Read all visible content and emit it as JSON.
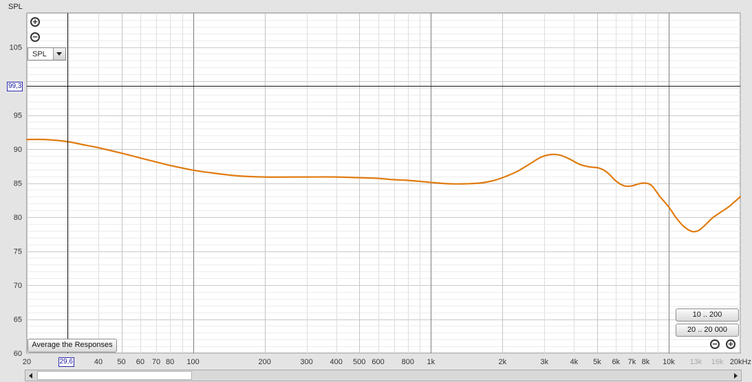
{
  "chart_data": {
    "type": "line",
    "ylabel": "SPL",
    "xunit": "Hz",
    "x_scale": "log",
    "xlim": [
      20,
      20000
    ],
    "ylim": [
      60,
      110
    ],
    "y_ticks": [
      60,
      65,
      70,
      75,
      80,
      85,
      90,
      95,
      105
    ],
    "x_ticks": [
      {
        "value": 20,
        "label": "20"
      },
      {
        "value": 40,
        "label": "40"
      },
      {
        "value": 50,
        "label": "50"
      },
      {
        "value": 60,
        "label": "60"
      },
      {
        "value": 70,
        "label": "70"
      },
      {
        "value": 80,
        "label": "80"
      },
      {
        "value": 100,
        "label": "100"
      },
      {
        "value": 200,
        "label": "200"
      },
      {
        "value": 300,
        "label": "300"
      },
      {
        "value": 400,
        "label": "400"
      },
      {
        "value": 500,
        "label": "500"
      },
      {
        "value": 600,
        "label": "600"
      },
      {
        "value": 800,
        "label": "800"
      },
      {
        "value": 1000,
        "label": "1k"
      },
      {
        "value": 2000,
        "label": "2k"
      },
      {
        "value": 3000,
        "label": "3k"
      },
      {
        "value": 4000,
        "label": "4k"
      },
      {
        "value": 5000,
        "label": "5k"
      },
      {
        "value": 6000,
        "label": "6k"
      },
      {
        "value": 7000,
        "label": "7k"
      },
      {
        "value": 8000,
        "label": "8k"
      },
      {
        "value": 10000,
        "label": "10k"
      },
      {
        "value": 13000,
        "label": "13k",
        "dim": true
      },
      {
        "value": 16000,
        "label": "16k",
        "dim": true
      },
      {
        "value": 20000,
        "label": "20kHz"
      }
    ],
    "cursor": {
      "x": 29.6,
      "y": 99.3,
      "x_label": "29,6",
      "y_label": "99,3"
    },
    "grid": true,
    "series": [
      {
        "color": "#e07b10",
        "points": [
          [
            20,
            91.4
          ],
          [
            24,
            91.4
          ],
          [
            29.6,
            91.1
          ],
          [
            35,
            90.6
          ],
          [
            40,
            90.2
          ],
          [
            50,
            89.4
          ],
          [
            60,
            88.7
          ],
          [
            70,
            88.1
          ],
          [
            80,
            87.6
          ],
          [
            100,
            86.9
          ],
          [
            120,
            86.5
          ],
          [
            150,
            86.1
          ],
          [
            200,
            85.9
          ],
          [
            300,
            85.9
          ],
          [
            400,
            85.9
          ],
          [
            500,
            85.8
          ],
          [
            600,
            85.7
          ],
          [
            700,
            85.5
          ],
          [
            800,
            85.4
          ],
          [
            1000,
            85.1
          ],
          [
            1200,
            84.9
          ],
          [
            1400,
            84.9
          ],
          [
            1600,
            85.0
          ],
          [
            1800,
            85.3
          ],
          [
            2000,
            85.8
          ],
          [
            2300,
            86.7
          ],
          [
            2600,
            87.8
          ],
          [
            2900,
            88.8
          ],
          [
            3200,
            89.2
          ],
          [
            3500,
            89.1
          ],
          [
            3800,
            88.6
          ],
          [
            4200,
            87.8
          ],
          [
            4600,
            87.4
          ],
          [
            5100,
            87.2
          ],
          [
            5500,
            86.6
          ],
          [
            6000,
            85.3
          ],
          [
            6500,
            84.6
          ],
          [
            7000,
            84.6
          ],
          [
            7500,
            84.9
          ],
          [
            8000,
            85.0
          ],
          [
            8500,
            84.6
          ],
          [
            9200,
            83.0
          ],
          [
            10000,
            81.5
          ],
          [
            10800,
            79.8
          ],
          [
            11600,
            78.6
          ],
          [
            12500,
            77.9
          ],
          [
            13300,
            78.0
          ],
          [
            14200,
            78.8
          ],
          [
            15300,
            79.9
          ],
          [
            16500,
            80.7
          ],
          [
            18000,
            81.6
          ],
          [
            20000,
            83.0
          ]
        ]
      }
    ]
  },
  "ui": {
    "zoom_in_glyph": "+",
    "zoom_out_glyph": "−",
    "measurement_select": {
      "value": "SPL"
    },
    "average_button": "Average the Responses",
    "range_buttons": [
      "10 .. 200",
      "20 .. 20 000"
    ],
    "icons": [
      "zoom-in-icon",
      "zoom-out-icon",
      "chevron-down-icon",
      "arrow-left-icon",
      "arrow-right-icon"
    ]
  }
}
